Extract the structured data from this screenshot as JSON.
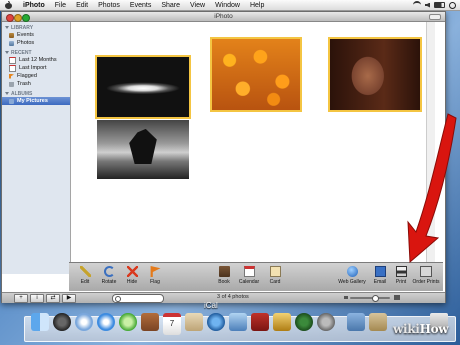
{
  "menubar": {
    "app_name": "iPhoto",
    "items": [
      "File",
      "Edit",
      "Photos",
      "Events",
      "Share",
      "View",
      "Window",
      "Help"
    ]
  },
  "window": {
    "title": "iPhoto"
  },
  "sidebar": {
    "sections": [
      {
        "header": "LIBRARY",
        "items": [
          {
            "label": "Events",
            "icon": "events-icon"
          },
          {
            "label": "Photos",
            "icon": "photos-icon"
          }
        ]
      },
      {
        "header": "RECENT",
        "items": [
          {
            "label": "Last 12 Months",
            "icon": "calendar-icon"
          },
          {
            "label": "Last Import",
            "icon": "calendar-icon"
          },
          {
            "label": "Flagged",
            "icon": "flag-icon"
          },
          {
            "label": "Trash",
            "icon": "trash-icon"
          }
        ]
      },
      {
        "header": "ALBUMS",
        "items": [
          {
            "label": "My Pictures",
            "icon": "folder-icon",
            "selected": true
          }
        ]
      }
    ]
  },
  "photos": [
    {
      "subject": "galaxy",
      "selected": true
    },
    {
      "subject": "orange flowers",
      "selected": true
    },
    {
      "subject": "buddha statue",
      "selected": true
    },
    {
      "subject": "rock silhouette",
      "selected": false
    }
  ],
  "toolbar": {
    "buttons": [
      {
        "label": "Edit",
        "icon": "edit-icon"
      },
      {
        "label": "Rotate",
        "icon": "rotate-icon"
      },
      {
        "label": "Hide",
        "icon": "hide-icon"
      },
      {
        "label": "Flag",
        "icon": "flag-icon"
      },
      {
        "label": "Book",
        "icon": "book-icon"
      },
      {
        "label": "Calendar",
        "icon": "calendar-icon"
      },
      {
        "label": "Card",
        "icon": "card-icon"
      },
      {
        "label": "Web Gallery",
        "icon": "web-gallery-icon"
      },
      {
        "label": "Email",
        "icon": "email-icon"
      },
      {
        "label": "Print",
        "icon": "print-icon"
      },
      {
        "label": "Order Prints",
        "icon": "order-prints-icon"
      }
    ]
  },
  "statusbar": {
    "buttons": [
      "+",
      "i",
      "⇄",
      "▶"
    ],
    "photo_count": "3 of 4 photos"
  },
  "dock": {
    "hover_label": "iCal",
    "ical_date": "7"
  },
  "watermark": {
    "part1": "wiki",
    "part2": "How"
  },
  "colors": {
    "selection": "#f4c542",
    "arrow": "#d9150f",
    "sidebar": "#dfe6ef"
  }
}
